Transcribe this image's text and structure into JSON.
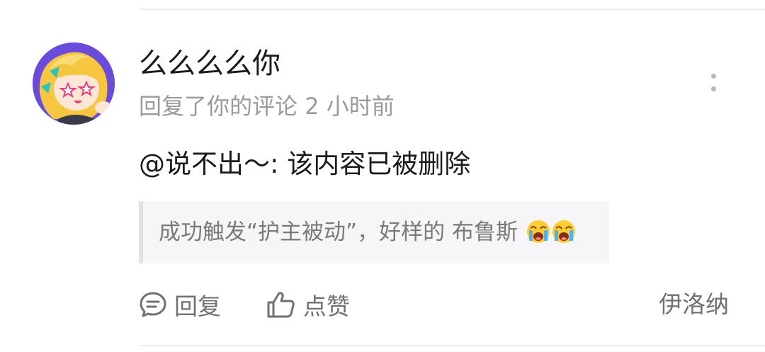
{
  "notification": {
    "username": "么么么么你",
    "action_text": "回复了你的评论",
    "time": "2 小时前",
    "content": "@说不出～: 该内容已被删除",
    "quote": {
      "text": "成功触发“护主被动”，好样的 布鲁斯",
      "emojis": [
        "loudly-crying-face",
        "loudly-crying-face"
      ]
    },
    "actions": {
      "reply_label": "回复",
      "like_label": "点赞"
    },
    "source": "伊洛纳"
  },
  "colors": {
    "text_primary": "#1a1a1a",
    "text_secondary": "#9a9a9a",
    "action_gray": "#707070",
    "avatar_bg": "#6a4bdc"
  },
  "icons": {
    "more": "more-vertical-icon",
    "reply": "comment-bubble-icon",
    "like": "thumbs-up-icon"
  }
}
